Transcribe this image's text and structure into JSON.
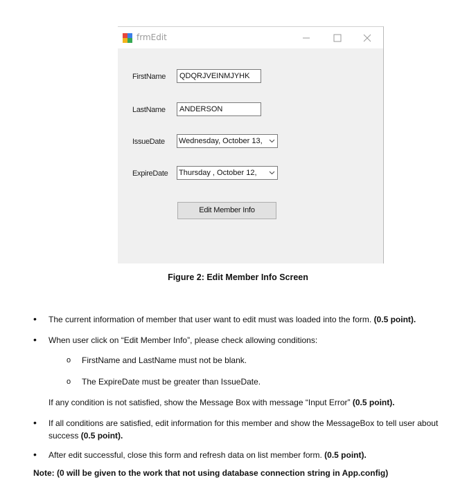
{
  "window": {
    "title": "frmEdit",
    "controls": {
      "minimize": "—",
      "maximize": "☐",
      "close": "✕"
    }
  },
  "form": {
    "first_name": {
      "label": "FirstName",
      "value": "QDQRJVEINMJYHK"
    },
    "last_name": {
      "label": "LastName",
      "value": "ANDERSON"
    },
    "issue_date": {
      "label": "IssueDate",
      "value": "Wednesday,  October  13,"
    },
    "expire_date": {
      "label": "ExpireDate",
      "value": "Thursday  ,  October  12,"
    },
    "submit_label": "Edit Member Info"
  },
  "caption": "Figure 2: Edit Member Info Screen",
  "requirements": [
    {
      "bullet": "•",
      "text": "The current information of member that user want to edit must was loaded into the form.",
      "points": "(0.5 point)."
    },
    {
      "bullet": "•",
      "text": "When user click on “Edit Member Info”, please check allowing conditions:"
    },
    {
      "bullet": "o",
      "text": "FirstName and LastName must not be blank."
    },
    {
      "bullet": "o",
      "text": "The ExpireDate must be greater than IssueDate."
    },
    {
      "text": "If any condition is not satisfied, show the Message Box with message “Input Error”",
      "points": "(0.5 point)."
    },
    {
      "bullet": "•",
      "text": "If all conditions are satisfied, edit information for this member and show the MessageBox to tell user about success",
      "points": "(0.5 point)."
    },
    {
      "bullet": "•",
      "text": "After edit successful, close this form and refresh data on list member form.",
      "points": "(0.5 point)."
    }
  ],
  "note": "Note: (0 will be given to the work that not using database connection string in App.config)",
  "colors": {
    "form_bg": "#f0f0f0",
    "title_text": "#9a9a9a",
    "button_bg": "#e1e1e1"
  }
}
